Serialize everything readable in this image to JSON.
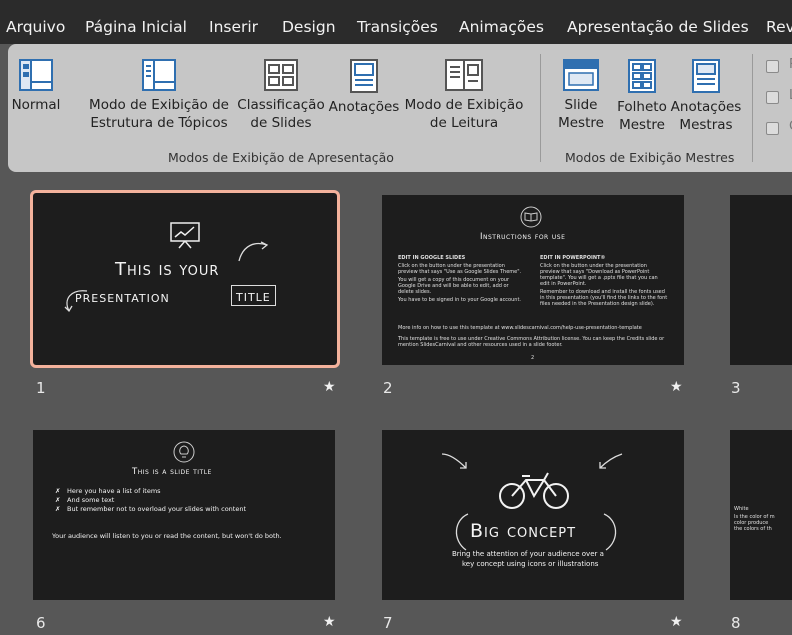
{
  "menu": {
    "items": [
      "Arquivo",
      "Página Inicial",
      "Inserir",
      "Design",
      "Transições",
      "Animações",
      "Apresentação de Slides",
      "Rev"
    ]
  },
  "ribbon": {
    "presentation_views": {
      "normal": "Normal",
      "outline_line1": "Modo de Exibição de",
      "outline_line2": "Estrutura de Tópicos",
      "sorter_line1": "Classificação",
      "sorter_line2": "de Slides",
      "notes": "Anotações",
      "reading_line1": "Modo de Exibição",
      "reading_line2": "de Leitura",
      "group_label": "Modos de Exibição de Apresentação"
    },
    "master_views": {
      "slide_master_line1": "Slide",
      "slide_master_line2": "Mestre",
      "handout_line1": "Folheto",
      "handout_line2": "Mestre",
      "notes_master_line1": "Anotações",
      "notes_master_line2": "Mestras",
      "group_label": "Modos de Exibição Mestres"
    },
    "show_checkboxes": [
      {
        "label": "R",
        "checked": false
      },
      {
        "label": "L",
        "checked": false
      },
      {
        "label": "G",
        "checked": false
      }
    ]
  },
  "slides": {
    "s1": {
      "number": "1",
      "title_line1": "This is your",
      "title_word1": "presentation",
      "title_word2": "title"
    },
    "s2": {
      "number": "2",
      "heading": "Instructions for use",
      "col1_heading": "EDIT IN GOOGLE SLIDES",
      "col1_lines": [
        "Click on the button under the presentation",
        "preview that says \"Use as Google Slides Theme\".",
        "You will get a copy of this document on your",
        "Google Drive and will be able to edit, add or",
        "delete slides.",
        "You have to be signed in to your Google account."
      ],
      "col2_heading": "EDIT IN POWERPOINT®",
      "col2_lines": [
        "Click on the button under the presentation",
        "preview that says \"Download as PowerPoint",
        "template\". You will get a .pptx file that you can",
        "edit in PowerPoint.",
        "Remember to download and install the fonts used",
        "in this presentation (you'll find the links to the font",
        "files needed in the Presentation design slide)."
      ],
      "footer_lines": [
        "More info on how to use this template at www.slidescarnival.com/help-use-presentation-template",
        "This template is free to use under Creative Commons Attribution license. You can keep the Credits slide or",
        "mention SlidesCarnival and other resources used in a slide footer."
      ],
      "page": "2"
    },
    "s3": {
      "number": "3"
    },
    "s6": {
      "number": "6",
      "title": "This is a slide title",
      "bullets": [
        "Here you have a list of items",
        "And some text",
        "But remember not to overload your slides with content"
      ],
      "footer": "Your audience will listen to you or read the content, but won't do both."
    },
    "s7": {
      "number": "7",
      "title": "Big concept",
      "subtitle_line1": "Bring the attention of your audience over a",
      "subtitle_line2": "key concept using icons or illustrations"
    },
    "s8": {
      "number": "8",
      "text_lines": [
        "White",
        "Is the color of m",
        "color produce",
        "the colors of th"
      ]
    }
  },
  "icons": {
    "star": "★"
  },
  "colors": {
    "menubar": "#2b2b2b",
    "ribbon": "#c6c6c6",
    "workspace": "#575757",
    "selection": "#f4b29c",
    "icon_blue": "#2f6fb0"
  }
}
